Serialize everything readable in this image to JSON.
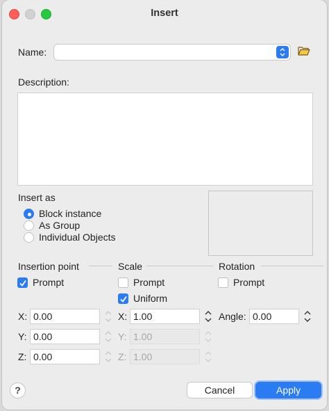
{
  "window": {
    "title": "Insert"
  },
  "name_row": {
    "label": "Name:",
    "value": ""
  },
  "description": {
    "label": "Description:",
    "value": ""
  },
  "insert_as": {
    "label": "Insert as",
    "options": [
      "Block instance",
      "As Group",
      "Individual Objects"
    ],
    "selected": "Block instance"
  },
  "insertion_point": {
    "title": "Insertion point",
    "prompt_label": "Prompt",
    "prompt_checked": true,
    "x_label": "X:",
    "x": "0.00",
    "y_label": "Y:",
    "y": "0.00",
    "z_label": "Z:",
    "z": "0.00"
  },
  "scale": {
    "title": "Scale",
    "prompt_label": "Prompt",
    "prompt_checked": false,
    "uniform_label": "Uniform",
    "uniform_checked": true,
    "x_label": "X:",
    "x": "1.00",
    "y_label": "Y:",
    "y": "1.00",
    "z_label": "Z:",
    "z": "1.00"
  },
  "rotation": {
    "title": "Rotation",
    "prompt_label": "Prompt",
    "prompt_checked": false,
    "angle_label": "Angle:",
    "angle": "0.00"
  },
  "footer": {
    "help": "?",
    "cancel": "Cancel",
    "apply": "Apply"
  },
  "colors": {
    "accent": "#2b7bf2",
    "window_bg": "#ececec"
  }
}
